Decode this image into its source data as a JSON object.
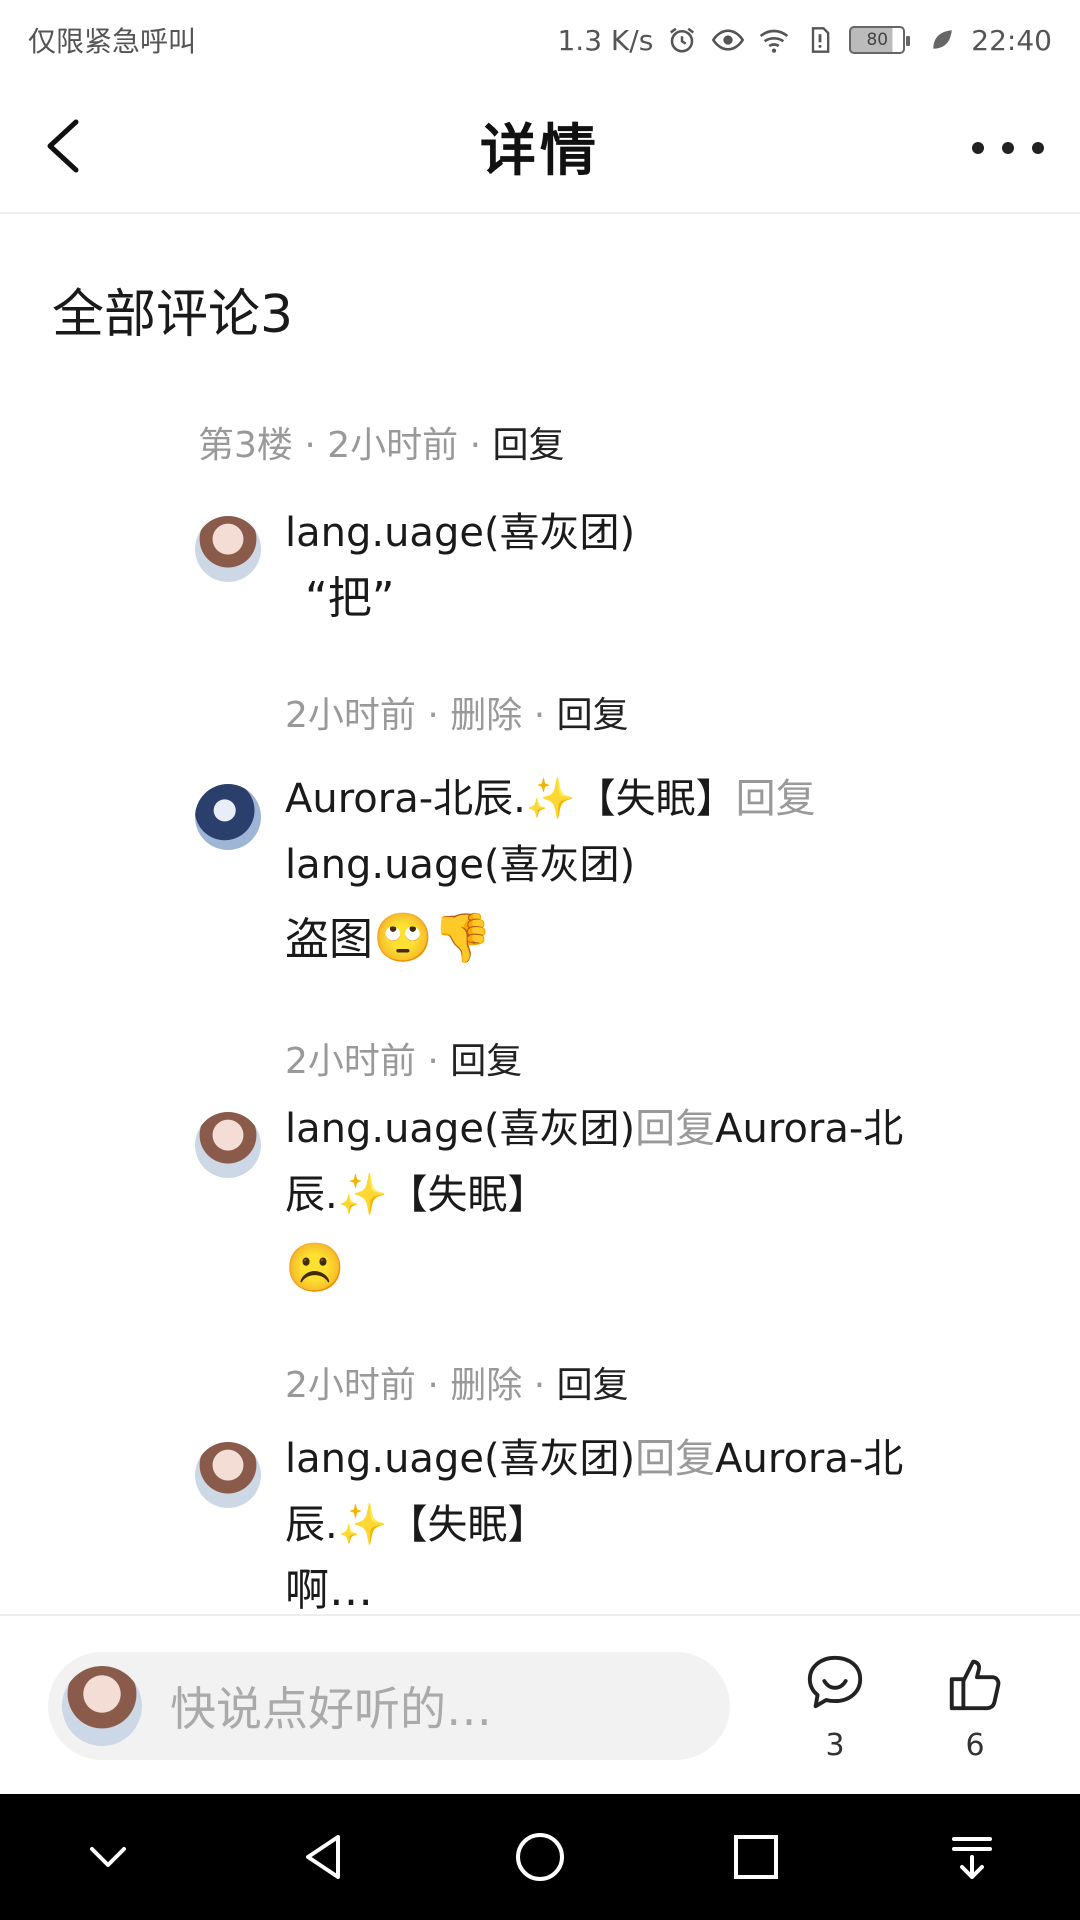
{
  "status_bar": {
    "carrier": "仅限紧急呼叫",
    "speed": "1.3 K/s",
    "battery": "80",
    "time": "22:40"
  },
  "header": {
    "title": "详情"
  },
  "comments": {
    "header": "全部评论3",
    "floor": "第3楼",
    "floor_time": "2小时前",
    "floor_reply": "回复",
    "items": [
      {
        "user": "lang.uage(喜灰团)",
        "text": "“把”",
        "time": "2小时前",
        "delete": "删除",
        "reply": "回复"
      },
      {
        "user": "Aurora-北辰.",
        "user_suffix": "【失眠】",
        "reply_word": "回复",
        "target": "lang.uage(喜灰团)",
        "text": "盗图",
        "emoji": "🙄👎",
        "time": "2小时前",
        "reply": "回复"
      },
      {
        "user": "lang.uage(喜灰团)",
        "reply_word": "回复",
        "target": "Aurora-北辰.",
        "target_suffix": "【失眠】",
        "emoji": "☹️",
        "time": "2小时前",
        "delete": "删除",
        "reply": "回复"
      },
      {
        "user": "lang.uage(喜灰团)",
        "reply_word": "回复",
        "target": "Aurora-北辰.",
        "target_suffix": "【失眠】",
        "text": "啊…"
      }
    ]
  },
  "input_bar": {
    "placeholder": "快说点好听的…",
    "comment_count": "3",
    "like_count": "6"
  },
  "colors": {
    "muted": "#999999",
    "text": "#1a1a1a",
    "nav": "#000000"
  },
  "icons": [
    "back-icon",
    "more-icon",
    "comment-icon",
    "like-icon",
    "collapse-icon",
    "nav-back-icon",
    "nav-home-icon",
    "nav-recents-icon",
    "nav-notification-icon"
  ]
}
